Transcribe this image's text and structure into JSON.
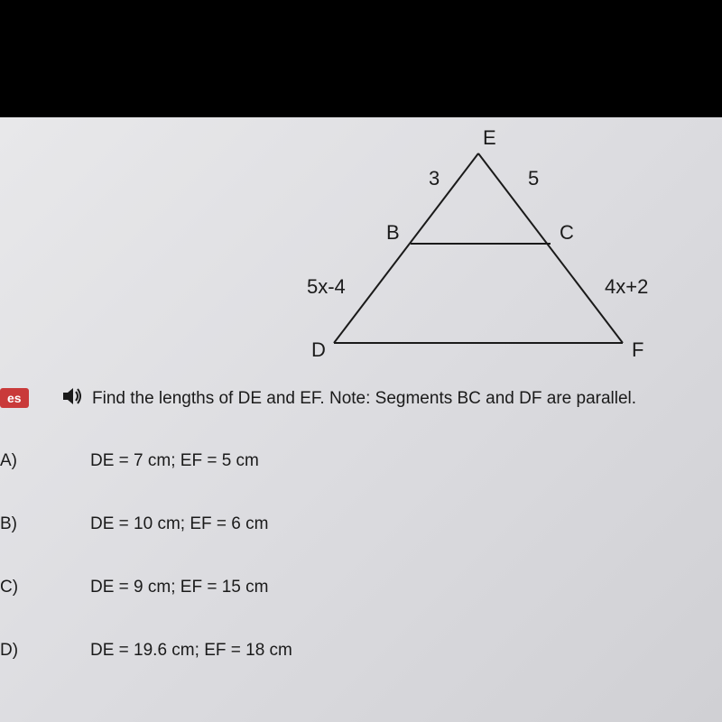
{
  "diagram": {
    "vertex_E": "E",
    "vertex_B": "B",
    "vertex_C": "C",
    "vertex_D": "D",
    "vertex_F": "F",
    "segment_EB": "3",
    "segment_EC": "5",
    "segment_BD": "5x-4",
    "segment_CF": "4x+2"
  },
  "badge": "es",
  "question": "Find the lengths of DE and EF. Note: Segments BC and DF are parallel.",
  "options": {
    "A": {
      "letter": "A)",
      "text": "DE = 7 cm; EF = 5 cm"
    },
    "B": {
      "letter": "B)",
      "text": "DE = 10 cm; EF = 6 cm"
    },
    "C": {
      "letter": "C)",
      "text": "DE = 9 cm; EF = 15 cm"
    },
    "D": {
      "letter": "D)",
      "text": "DE = 19.6 cm; EF = 18 cm"
    }
  },
  "chart_data": {
    "type": "diagram",
    "description": "Triangle DEF with midsegment BC parallel to DF",
    "points": {
      "E": "apex",
      "B": "on segment ED",
      "C": "on segment EF",
      "D": "bottom-left",
      "F": "bottom-right"
    },
    "segment_labels": {
      "EB": "3",
      "EC": "5",
      "BD": "5x-4",
      "CF": "4x+2"
    },
    "parallel_segments": [
      "BC",
      "DF"
    ]
  }
}
